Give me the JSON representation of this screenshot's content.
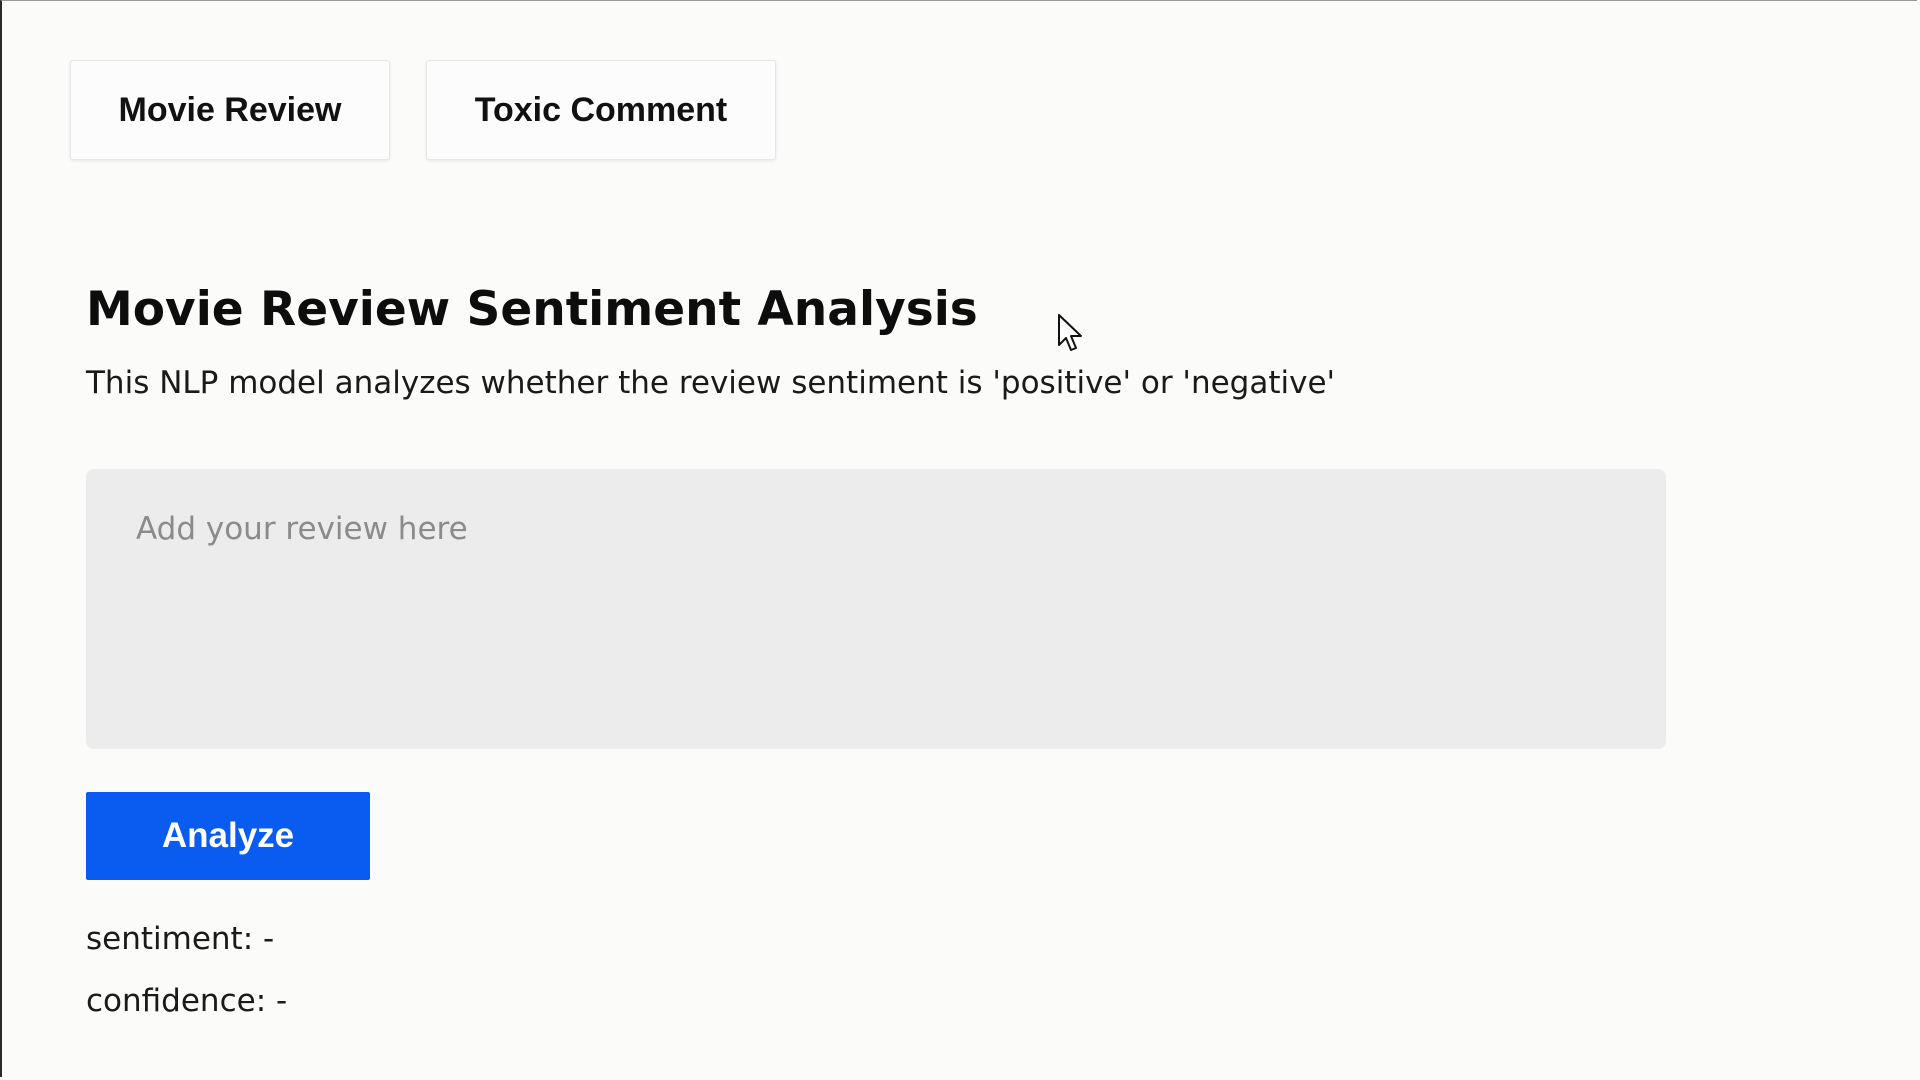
{
  "tabs": [
    {
      "label": "Movie Review"
    },
    {
      "label": "Toxic Comment"
    }
  ],
  "main": {
    "title": "Movie Review Sentiment Analysis",
    "description": "This NLP model analyzes whether the review sentiment is 'positive' or 'negative'",
    "review_input": {
      "value": "",
      "placeholder": "Add your review here"
    },
    "analyze_label": "Analyze",
    "sentiment_label": "sentiment: -",
    "confidence_label": "confidence: -"
  },
  "colors": {
    "accent": "#0a5cf0",
    "background": "#fbfbfa",
    "input_background": "#ececec"
  },
  "icons": {
    "cursor": "mouse-pointer-icon"
  }
}
